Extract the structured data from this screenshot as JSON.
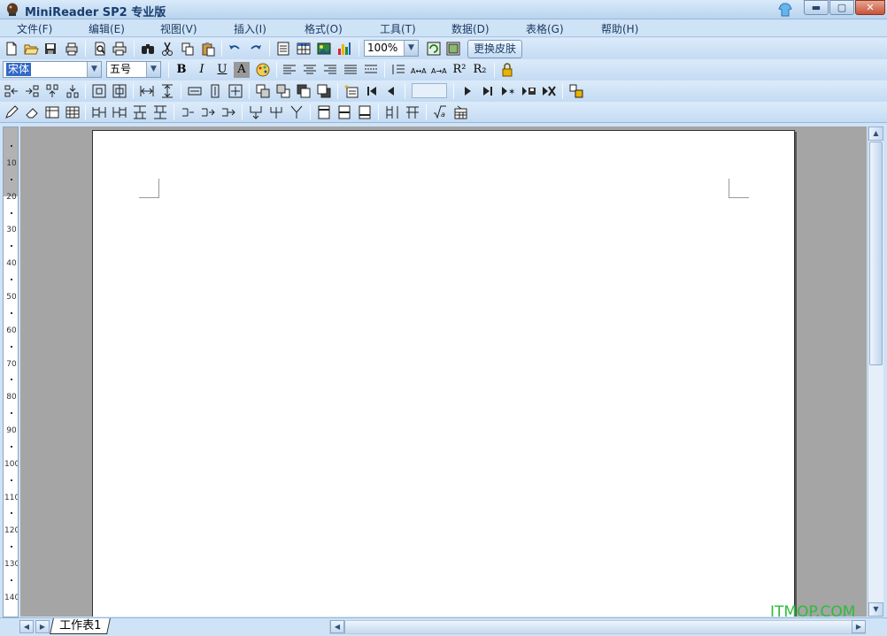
{
  "window": {
    "title": "MiniReader SP2 专业版",
    "minimize": "▬",
    "maximize": "▢",
    "close": "✕"
  },
  "menu": [
    "文件(F)",
    "编辑(E)",
    "视图(V)",
    "插入(I)",
    "格式(O)",
    "工具(T)",
    "数据(D)",
    "表格(G)",
    "帮助(H)"
  ],
  "format": {
    "font": "宋体",
    "size": "五号",
    "bold": "B",
    "italic": "I",
    "underline": "U",
    "shade": "A",
    "superscript": "R²",
    "subscript": "R₂"
  },
  "zoom": "100%",
  "skin_button": "更换皮肤",
  "ruler": [
    "10",
    "20",
    "30",
    "40",
    "50",
    "60",
    "70",
    "80",
    "90",
    "100",
    "110",
    "120",
    "130",
    "140"
  ],
  "sheet_tab": "工作表1",
  "watermark": "ITMOP.COM",
  "colors": {
    "accent": "#3169c6",
    "menu_text": "#1b3a63",
    "toolbar": "#c4dbf3",
    "workspace": "#a5a5a5"
  }
}
